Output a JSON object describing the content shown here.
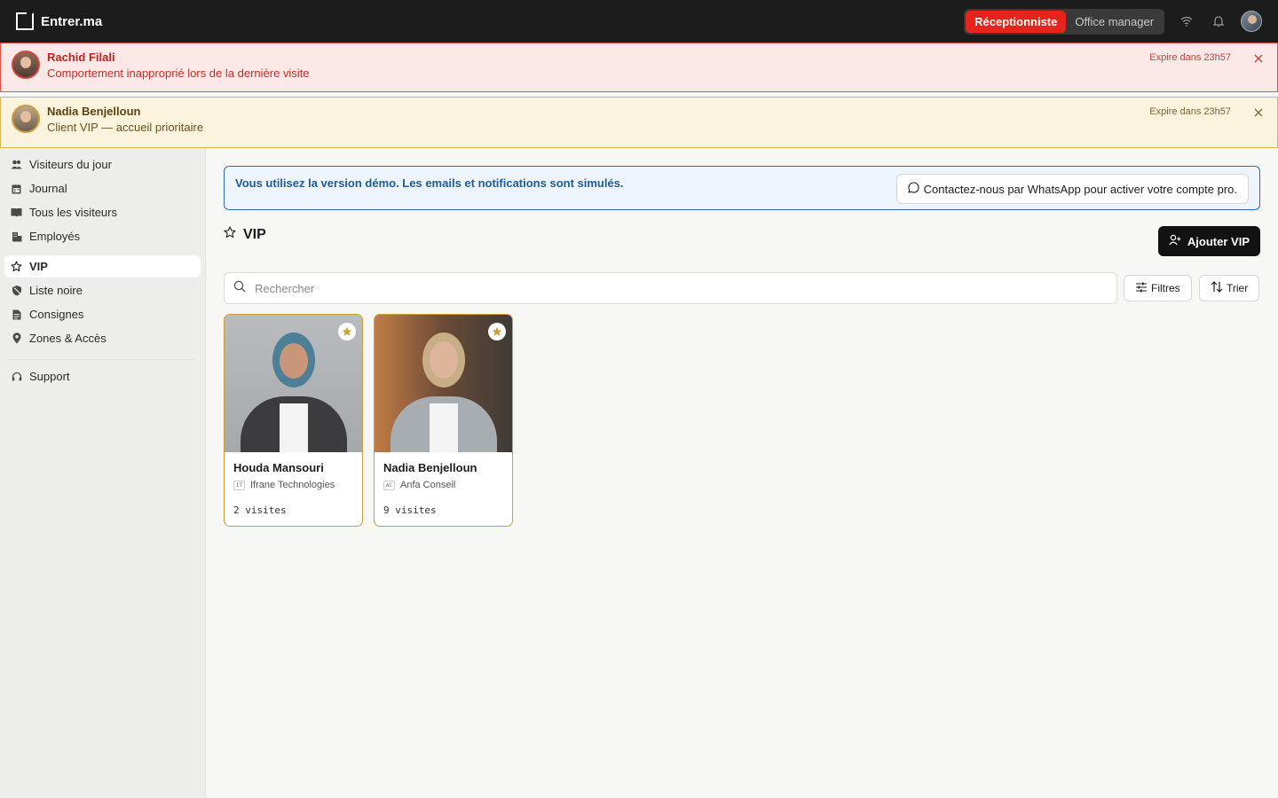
{
  "app": {
    "name": "Entrer.ma"
  },
  "roles": [
    {
      "label": "Réceptionniste",
      "active": true
    },
    {
      "label": "Office manager",
      "active": false
    }
  ],
  "alerts": [
    {
      "name": "Rachid Filali",
      "message": "Comportement inapproprié lors de la dernière visite",
      "expire": "Expire dans 23h57",
      "level": "danger",
      "color": "#e0514a"
    },
    {
      "name": "Nadia Benjelloun",
      "message": "Client VIP — accueil prioritaire",
      "expire": "Expire dans 23h57",
      "level": "vip",
      "color": "#d7b657"
    }
  ],
  "sidebar": {
    "items": [
      {
        "label": "Visiteurs du jour",
        "icon": "users-icon"
      },
      {
        "label": "Journal",
        "icon": "calendar-icon"
      },
      {
        "label": "Tous les visiteurs",
        "icon": "book-icon"
      },
      {
        "label": "Employés",
        "icon": "building-icon"
      },
      {
        "label": "VIP",
        "icon": "star-icon",
        "active": true
      },
      {
        "label": "Liste noire",
        "icon": "shield-icon"
      },
      {
        "label": "Consignes",
        "icon": "document-icon"
      },
      {
        "label": "Zones & Accès",
        "icon": "map-pin-icon"
      },
      {
        "label": "Support",
        "icon": "headset-icon"
      }
    ]
  },
  "demo_banner": {
    "text": "Vous utilisez la version démo. Les emails et notifications sont simulés.",
    "button": "Contactez-nous par WhatsApp pour activer votre compte pro."
  },
  "page": {
    "title": "VIP",
    "add_button": "Ajouter VIP"
  },
  "search": {
    "placeholder": "Rechercher"
  },
  "toolbar": {
    "filters": "Filtres",
    "sort": "Trier"
  },
  "vips": [
    {
      "name": "Houda Mansouri",
      "company": "Ifrane Technologies",
      "company_abbr": "IT",
      "visits": "2 visites"
    },
    {
      "name": "Nadia Benjelloun",
      "company": "Anfa Conseil",
      "company_abbr": "AC",
      "visits": "9 visites"
    }
  ],
  "colors": {
    "accent_red": "#e6231c",
    "vip_gold": "#c99f3c",
    "demo_blue": "#2b6cb3",
    "dark": "#1c1c1c"
  }
}
